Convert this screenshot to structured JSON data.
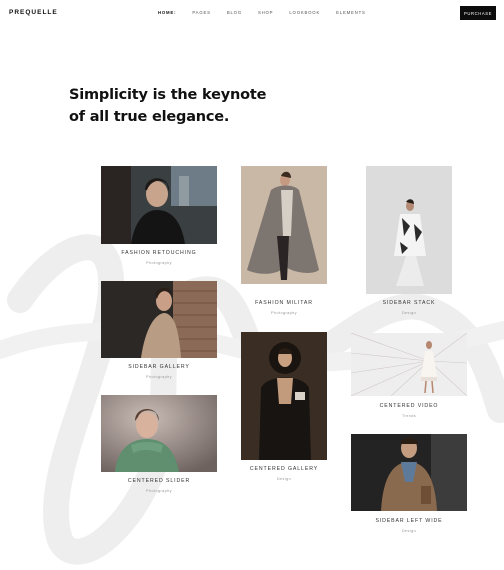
{
  "brand": {
    "logo": "PREQUELLE"
  },
  "nav": {
    "items": [
      {
        "label": "HOME:",
        "active": true
      },
      {
        "label": "PAGES"
      },
      {
        "label": "BLOG"
      },
      {
        "label": "SHOP"
      },
      {
        "label": "LOOKBOOK"
      },
      {
        "label": "ELEMENTS"
      }
    ],
    "purchase_label": "PURCHASE"
  },
  "hero": {
    "line1": "Simplicity is the keynote",
    "line2": "of all true elegance."
  },
  "portfolio": [
    {
      "title": "FASHION RETOUCHING",
      "category": "Photography"
    },
    {
      "title": "SIDEBAR GALLERY",
      "category": "Photography"
    },
    {
      "title": "CENTERED SLIDER",
      "category": "Photography"
    },
    {
      "title": "FASHION MILITAR",
      "category": "Photography"
    },
    {
      "title": "CENTERED GALLERY",
      "category": "Design"
    },
    {
      "title": "SIDEBAR STACK",
      "category": "Design"
    },
    {
      "title": "CENTERED VIDEO",
      "category": "Trends"
    },
    {
      "title": "SIDEBAR LEFT WIDE",
      "category": "Design"
    }
  ],
  "colors": {
    "accent": "#0c0c0c",
    "watermark": "#eeeeee"
  }
}
